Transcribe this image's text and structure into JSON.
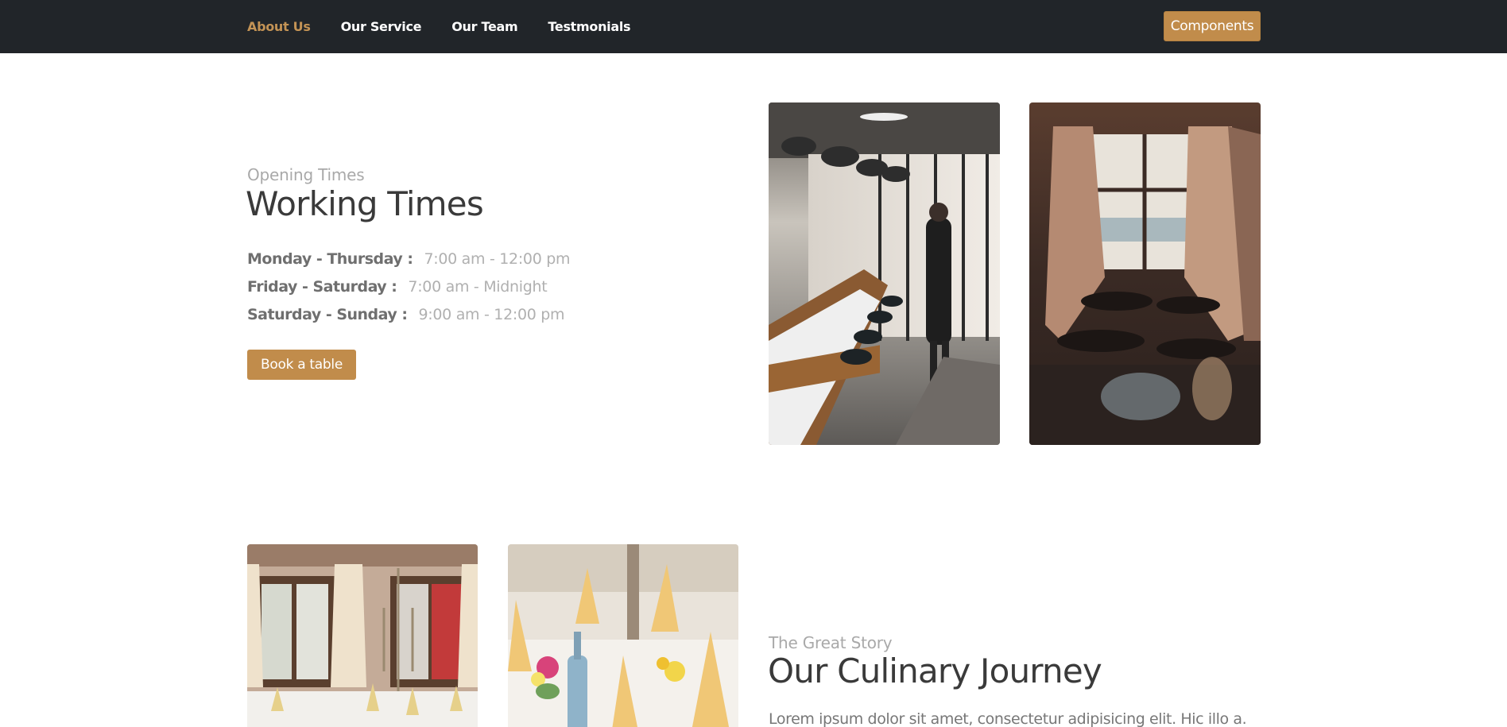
{
  "nav": {
    "links": [
      {
        "label": "About Us",
        "active": true
      },
      {
        "label": "Our Service",
        "active": false
      },
      {
        "label": "Our Team",
        "active": false
      },
      {
        "label": "Testmonials",
        "active": false
      }
    ],
    "cta_label": "Components"
  },
  "working": {
    "eyebrow": "Opening Times",
    "title": "Working Times",
    "rows": [
      {
        "day": "Monday - Thursday :",
        "time": "7:00 am - 12:00 pm"
      },
      {
        "day": "Friday - Saturday :",
        "time": "7:00 am - Midnight"
      },
      {
        "day": "Saturday - Sunday :",
        "time": "9:00 am - 12:00 pm"
      }
    ],
    "book_label": "Book a table"
  },
  "story": {
    "eyebrow": "The Great Story",
    "title": "Our Culinary Journey",
    "paragraph": "Lorem ipsum dolor sit amet, consectetur adipisicing elit. Hic illo a."
  },
  "colors": {
    "navbar_bg": "#212529",
    "accent": "#c18c4b",
    "active_link": "#c39355"
  }
}
